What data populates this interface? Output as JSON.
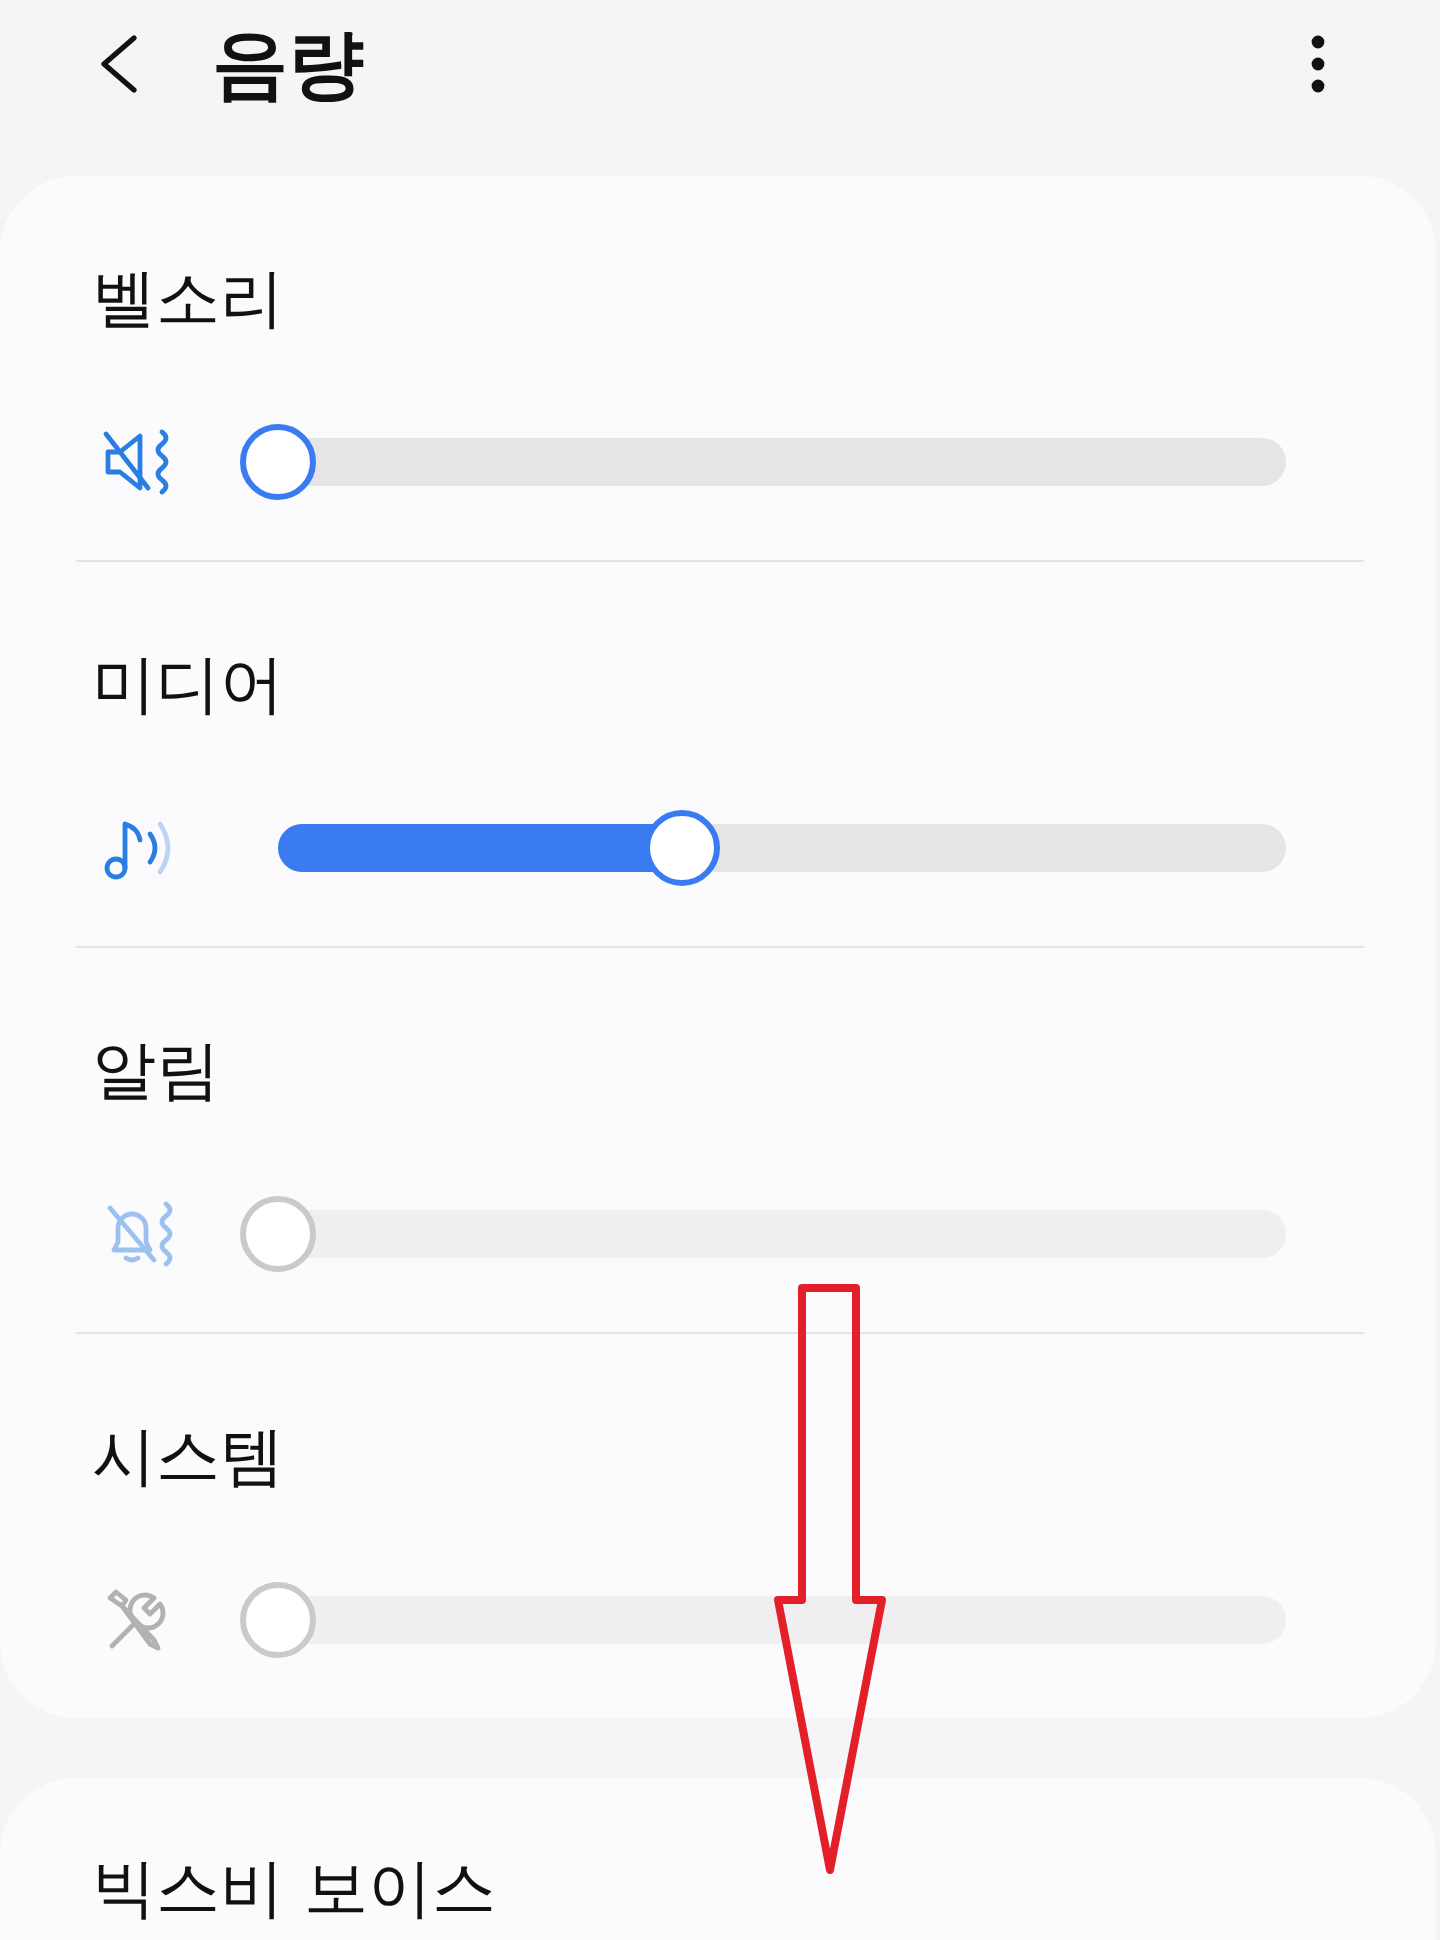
{
  "header": {
    "title": "음량"
  },
  "channels": [
    {
      "label": "벨소리",
      "level": 0,
      "disabled": false
    },
    {
      "label": "미디어",
      "level": 0.4,
      "disabled": false
    },
    {
      "label": "알림",
      "level": 0,
      "disabled": true
    },
    {
      "label": "시스템",
      "level": 0,
      "disabled": true
    }
  ],
  "next_section": {
    "label": "빅스비 보이스"
  },
  "annotation_arrow": true
}
